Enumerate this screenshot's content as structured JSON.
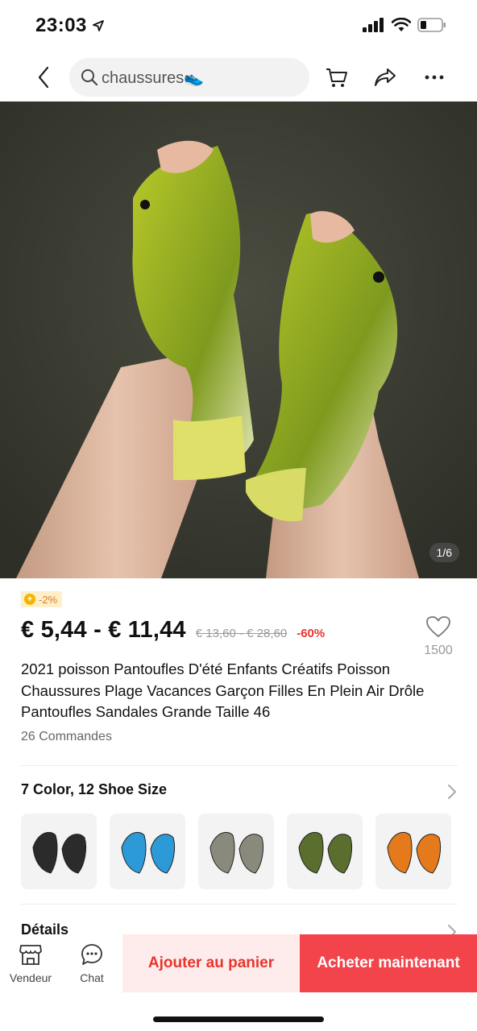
{
  "status": {
    "time": "23:03"
  },
  "search": {
    "query": "chaussures👟"
  },
  "product": {
    "image_counter": "1/6",
    "discount_badge": "-2%",
    "price": "€ 5,44 - € 11,44",
    "original_price": "€ 13,60 - € 28,60",
    "discount_pct": "-60%",
    "wishlist_count": "1500",
    "title": "2021 poisson Pantoufles D'été Enfants Créatifs Poisson Chaussures Plage Vacances Garçon Filles En Plein Air Drôle Pantoufles Sandales Grande Taille 46",
    "orders": "26 Commandes"
  },
  "variants": {
    "heading": "7 Color, 12 Shoe Size",
    "swatches": [
      {
        "name": "black",
        "color": "#2b2b2b"
      },
      {
        "name": "blue",
        "color": "#2d9ad8"
      },
      {
        "name": "grey",
        "color": "#8a8a7c"
      },
      {
        "name": "green",
        "color": "#5a6e2e"
      },
      {
        "name": "orange",
        "color": "#e47a1c"
      }
    ]
  },
  "details": {
    "heading": "Détails"
  },
  "bottom": {
    "store_label": "Vendeur",
    "chat_label": "Chat",
    "add_to_cart": "Ajouter au panier",
    "buy_now": "Acheter maintenant"
  },
  "colors": {
    "accent": "#f2444a",
    "accent_light": "#fdeceb",
    "price_red": "#e8352e"
  }
}
